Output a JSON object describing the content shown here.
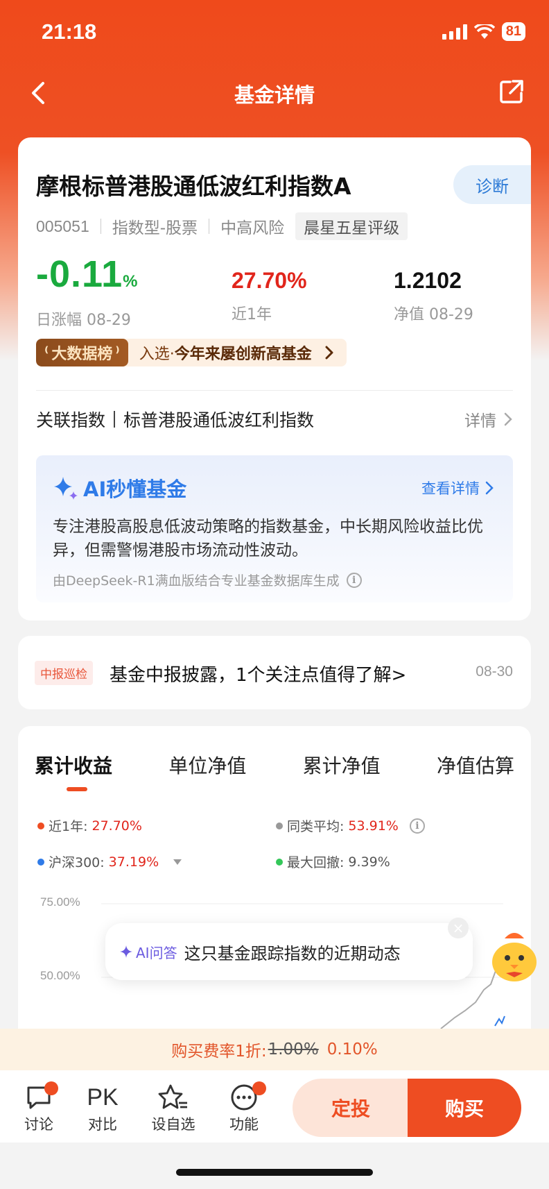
{
  "status": {
    "time": "21:18",
    "battery": "81"
  },
  "nav": {
    "title": "基金详情"
  },
  "fund": {
    "name": "摩根标普港股通低波红利指数A",
    "diagnose_label": "诊断",
    "code": "005051",
    "type": "指数型-股票",
    "risk": "中高风险",
    "rating": "晨星五星评级"
  },
  "metrics": {
    "daily_change": "-0.11",
    "daily_change_unit": "%",
    "daily_change_label": "日涨幅 08-29",
    "year_return": "27.70%",
    "year_return_label": "近1年",
    "nav_value": "1.2102",
    "nav_label": "净值 08-29"
  },
  "bigdata": {
    "tag": "大数据榜",
    "prefix": "入选·",
    "text": "今年来屡创新高基金"
  },
  "related_index": {
    "label": "关联指数",
    "name": "标普港股通低波红利指数",
    "detail": "详情"
  },
  "ai_summary": {
    "title": "AI秒懂基金",
    "more": "查看详情",
    "desc": "专注港股高股息低波动策略的指数基金，中长期风险收益比优异，但需警惕港股市场流动性波动。",
    "source": "由DeepSeek-R1满血版结合专业基金数据库生成"
  },
  "report": {
    "tag": "中报巡检",
    "text": "基金中报披露，1个关注点值得了解>",
    "date": "08-30"
  },
  "chart_tabs": [
    "累计收益",
    "单位净值",
    "累计净值",
    "净值估算"
  ],
  "chart_legend": {
    "fund_label": "近1年:",
    "fund_value": "27.70%",
    "peer_label": "同类平均:",
    "peer_value": "53.91%",
    "hs300_label": "沪深300:",
    "hs300_value": "37.19%",
    "drawdown_label": "最大回撤:",
    "drawdown_value": "9.39%"
  },
  "chart_data": {
    "type": "line",
    "y_tick_labels": [
      "75.00%",
      "50.00%"
    ],
    "series": [
      {
        "name": "近1年",
        "color": "#ee4d22"
      },
      {
        "name": "同类平均",
        "color": "#999999"
      },
      {
        "name": "沪深300",
        "color": "#2f7be8"
      }
    ]
  },
  "ai_popup": {
    "label": "AI问答",
    "text": "这只基金跟踪指数的近期动态"
  },
  "fee": {
    "label": "购买费率1折:",
    "original": "1.00%",
    "discounted": "0.10%"
  },
  "bottom": {
    "discuss": "讨论",
    "pk": "PK",
    "compare": "对比",
    "watchlist": "设自选",
    "features": "功能",
    "dingtou": "定投",
    "buy": "购买"
  }
}
